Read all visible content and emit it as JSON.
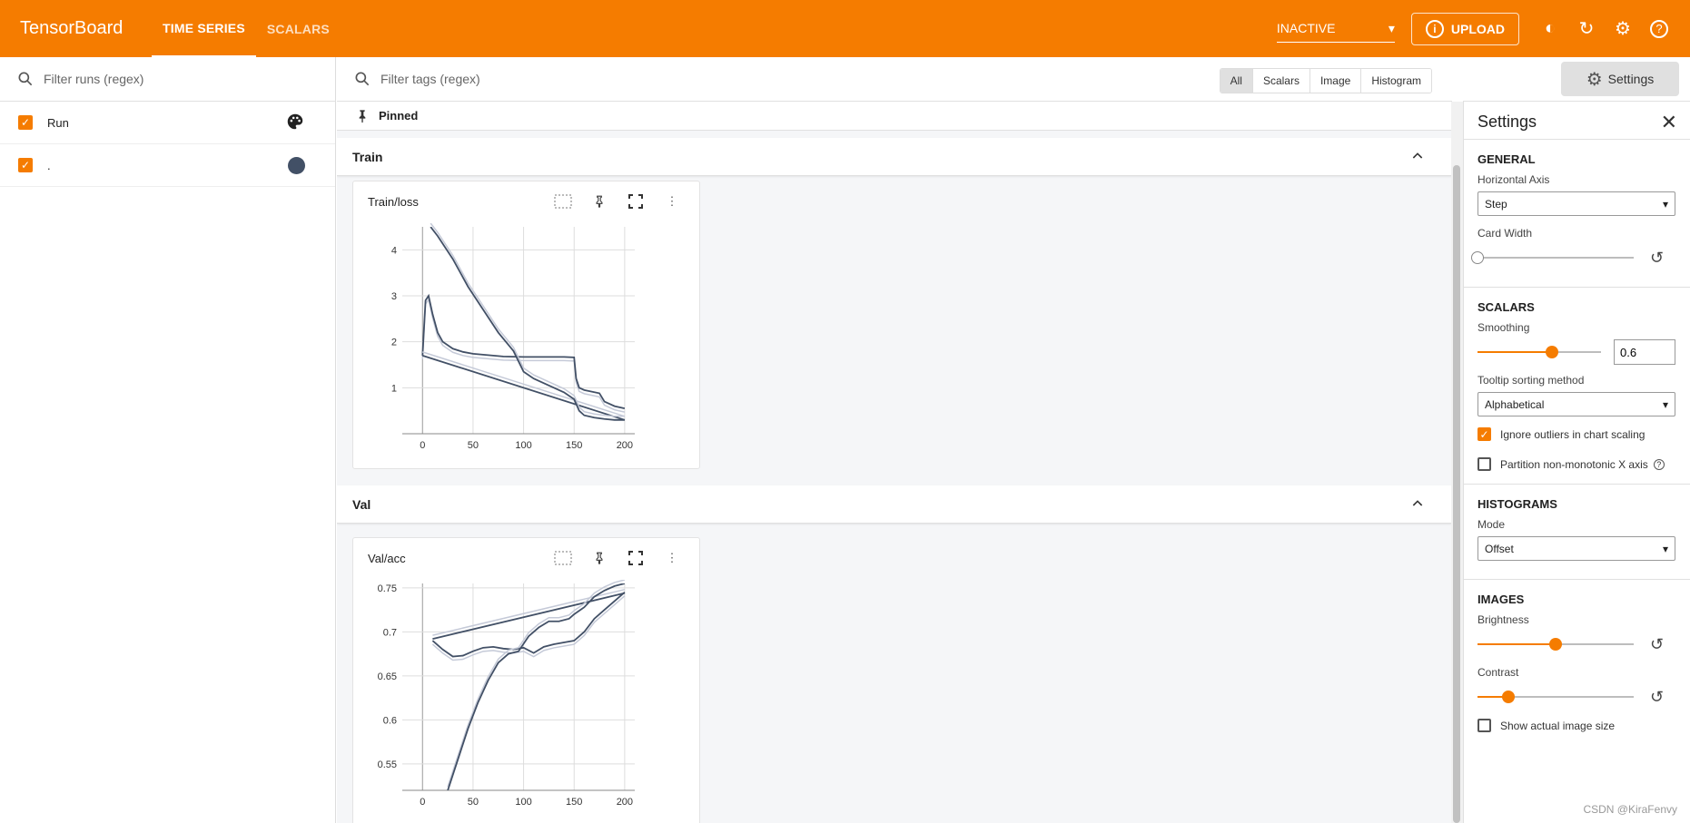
{
  "app": {
    "brand": "TensorBoard",
    "tabs": [
      "TIME SERIES",
      "SCALARS"
    ],
    "status_select": "INACTIVE",
    "upload_label": "UPLOAD"
  },
  "runs": {
    "filter_placeholder": "Filter runs (regex)",
    "items": [
      {
        "label": "Run",
        "checked": true
      },
      {
        "label": ".",
        "checked": true,
        "color": "#425066"
      }
    ]
  },
  "main": {
    "tag_filter_placeholder": "Filter tags (regex)",
    "type_chips": [
      "All",
      "Scalars",
      "Image",
      "Histogram"
    ],
    "settings_button": "Settings",
    "pinned_label": "Pinned",
    "groups": [
      {
        "title": "Train",
        "card_title": "Train/loss"
      },
      {
        "title": "Val",
        "card_title": "Val/acc"
      }
    ]
  },
  "settings": {
    "title": "Settings",
    "general": {
      "heading": "GENERAL",
      "horizontal_axis_label": "Horizontal Axis",
      "horizontal_axis_value": "Step",
      "card_width_label": "Card Width",
      "card_width_level": 0
    },
    "scalars": {
      "heading": "SCALARS",
      "smoothing_label": "Smoothing",
      "smoothing_value": "0.6",
      "tooltip_label": "Tooltip sorting method",
      "tooltip_value": "Alphabetical",
      "ignore_outliers_label": "Ignore outliers in chart scaling",
      "ignore_outliers_checked": true,
      "partition_label": "Partition non-monotonic X axis",
      "partition_checked": false
    },
    "histograms": {
      "heading": "HISTOGRAMS",
      "mode_label": "Mode",
      "mode_value": "Offset"
    },
    "images": {
      "heading": "IMAGES",
      "brightness_label": "Brightness",
      "brightness_level": 0.5,
      "contrast_label": "Contrast",
      "contrast_level": 0.2,
      "actual_size_label": "Show actual image size",
      "actual_size_checked": false
    }
  },
  "watermark": "CSDN @KiraFenvy",
  "colors": {
    "accent": "#f57c00",
    "series": "#425066",
    "series_light": "#c5cad8"
  },
  "chart_data": [
    {
      "type": "line",
      "title": "Train/loss",
      "x_ticks": [
        0,
        50,
        100,
        150,
        200
      ],
      "y_ticks": [
        1,
        2,
        3,
        4
      ],
      "xlim": [
        -20,
        210
      ],
      "ylim": [
        0,
        4.5
      ],
      "series": [
        {
          "x": [
            0,
            3,
            6,
            10,
            15,
            20,
            30,
            40,
            50,
            60,
            70,
            80,
            100,
            120,
            140,
            150,
            152,
            155,
            160,
            175,
            180,
            190,
            200
          ],
          "y": [
            1.7,
            2.9,
            3.0,
            2.6,
            2.2,
            2.0,
            1.85,
            1.78,
            1.74,
            1.72,
            1.7,
            1.68,
            1.67,
            1.67,
            1.67,
            1.66,
            1.2,
            1.0,
            0.95,
            0.88,
            0.7,
            0.6,
            0.55
          ]
        },
        {
          "x": [
            0,
            200
          ],
          "y": [
            1.7,
            0.3
          ]
        },
        {
          "x": [
            8,
            15,
            30,
            45,
            60,
            75,
            90,
            100,
            110,
            125,
            140,
            150,
            155,
            160,
            170,
            180,
            190,
            200
          ],
          "y": [
            4.5,
            4.3,
            3.8,
            3.2,
            2.7,
            2.2,
            1.8,
            1.35,
            1.2,
            1.05,
            0.9,
            0.75,
            0.5,
            0.4,
            0.35,
            0.32,
            0.3,
            0.3
          ]
        }
      ]
    },
    {
      "type": "line",
      "title": "Val/acc",
      "x_ticks": [
        0,
        50,
        100,
        150,
        200
      ],
      "y_ticks": [
        0.55,
        0.6,
        0.65,
        0.7,
        0.75
      ],
      "xlim": [
        -20,
        210
      ],
      "ylim": [
        0.52,
        0.755
      ],
      "series": [
        {
          "x": [
            10,
            20,
            30,
            40,
            50,
            60,
            70,
            80,
            90,
            100,
            110,
            120,
            130,
            140,
            150,
            160,
            170,
            180,
            190,
            200
          ],
          "y": [
            0.69,
            0.68,
            0.672,
            0.673,
            0.678,
            0.682,
            0.683,
            0.681,
            0.68,
            0.682,
            0.676,
            0.683,
            0.686,
            0.688,
            0.69,
            0.7,
            0.715,
            0.725,
            0.735,
            0.745
          ]
        },
        {
          "x": [
            10,
            200
          ],
          "y": [
            0.692,
            0.744
          ]
        },
        {
          "x": [
            25,
            35,
            45,
            55,
            65,
            75,
            85,
            95,
            105,
            115,
            125,
            135,
            145,
            150,
            160,
            170,
            180,
            190,
            200
          ],
          "y": [
            0.52,
            0.555,
            0.59,
            0.62,
            0.645,
            0.665,
            0.675,
            0.678,
            0.695,
            0.705,
            0.712,
            0.712,
            0.715,
            0.72,
            0.728,
            0.74,
            0.747,
            0.752,
            0.755
          ]
        }
      ]
    }
  ]
}
